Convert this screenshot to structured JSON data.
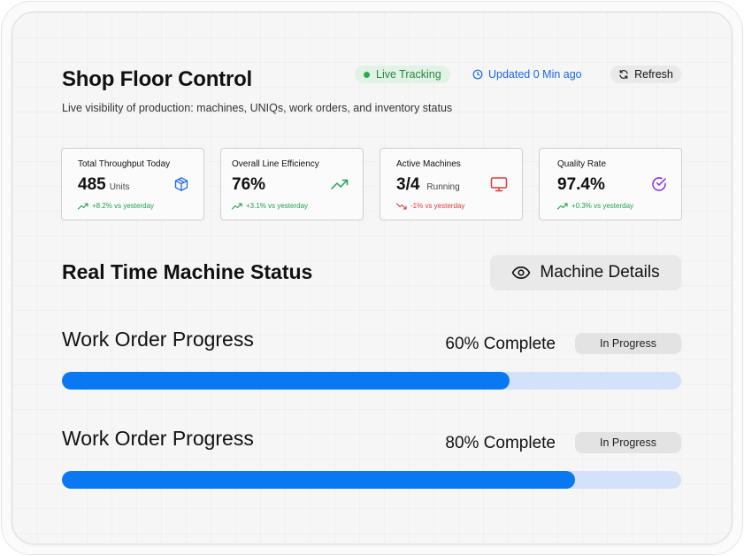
{
  "header": {
    "title": "Shop Floor Control",
    "subtitle": "Live visibility of production: machines, UNIQs, work orders, and inventory status",
    "live_label": "Live Tracking",
    "updated_label": "Updated 0 Min ago",
    "refresh_label": "Refresh"
  },
  "kpis": [
    {
      "label": "Total Throughput Today",
      "value": "485",
      "unit": "Units",
      "trend": "+8.2% vs yesterday",
      "direction": "up",
      "icon": "package-icon",
      "color": "#1a66e8"
    },
    {
      "label": "Overall Line Efficiency",
      "value": "76%",
      "unit": "",
      "trend": "+3.1% vs yesterday",
      "direction": "up",
      "icon": "trending-up-icon",
      "color": "#22a04a"
    },
    {
      "label": "Active Machines",
      "value": "3/4",
      "unit": "Running",
      "trend": "-1% vs yesterday",
      "direction": "down",
      "icon": "monitor-icon",
      "color": "#e03a3a"
    },
    {
      "label": "Quality Rate",
      "value": "97.4%",
      "unit": "",
      "trend": "+0.3% vs yesterday",
      "direction": "up",
      "icon": "check-circle-icon",
      "color": "#8a2be2"
    }
  ],
  "machine_status": {
    "title": "Real Time Machine Status",
    "details_label": "Machine Details"
  },
  "work_orders": [
    {
      "title": "Work Order Progress",
      "percent_label": "60% Complete",
      "status": "In Progress",
      "progress": 0.723
    },
    {
      "title": "Work Order Progress",
      "percent_label": "80% Complete",
      "status": "In Progress",
      "progress": 0.829
    }
  ],
  "colors": {
    "accent": "#0a78f0",
    "track": "#d3e2fa",
    "live": "#23883e",
    "link": "#1a66e8"
  }
}
